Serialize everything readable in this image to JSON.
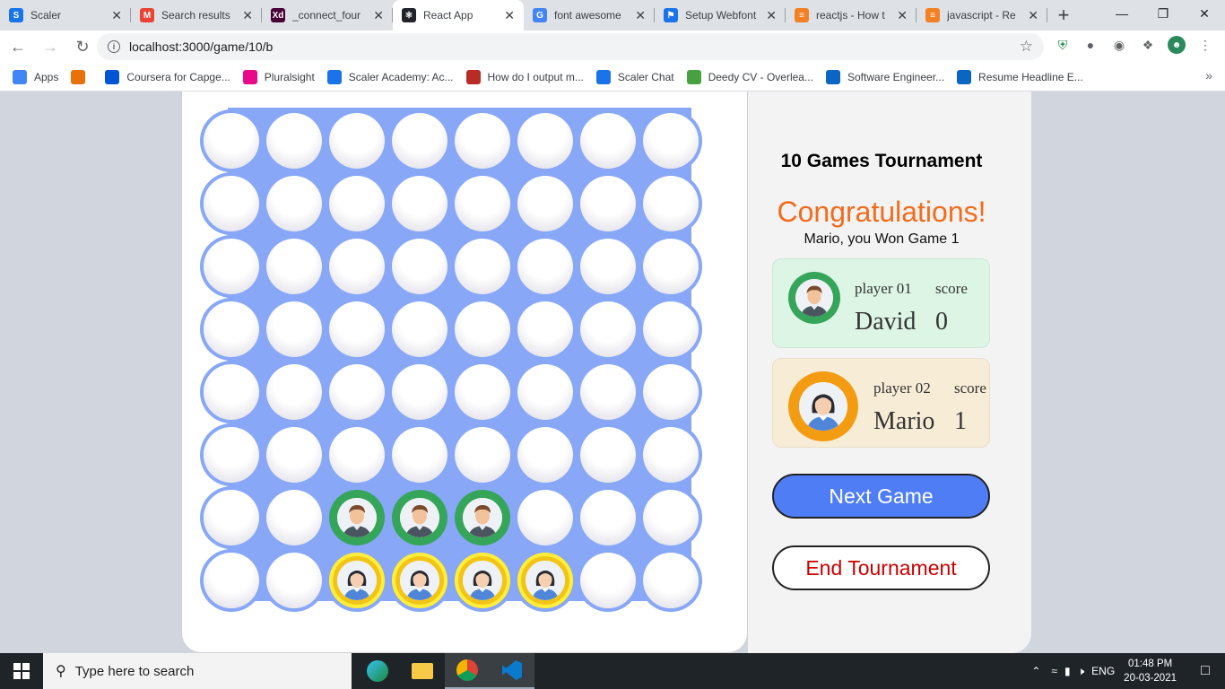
{
  "browser": {
    "tabs": [
      {
        "title": "Scaler",
        "favicon": "scaler-icon",
        "color": "#1a73e8",
        "active": false
      },
      {
        "title": "Search results",
        "favicon": "gmail-icon",
        "color": "#ea4335",
        "active": false
      },
      {
        "title": "_connect_four",
        "favicon": "adobe-xd-icon",
        "color": "#470137",
        "active": false
      },
      {
        "title": "React App",
        "favicon": "react-icon",
        "color": "#20232a",
        "active": true
      },
      {
        "title": "font awesome",
        "favicon": "google-icon",
        "color": "#4285f4",
        "active": false
      },
      {
        "title": "Setup Webfont",
        "favicon": "flag-icon",
        "color": "#1a73e8",
        "active": false
      },
      {
        "title": "reactjs - How t",
        "favicon": "stackoverflow-icon",
        "color": "#f48024",
        "active": false
      },
      {
        "title": "javascript - Re",
        "favicon": "stackoverflow-icon",
        "color": "#f48024",
        "active": false
      }
    ],
    "url": "localhost:3000/game/10/b",
    "bookmarks": [
      {
        "label": "Apps",
        "icon": "apps-grid-icon",
        "color": "#4285f4"
      },
      {
        "label": "",
        "icon": "library-icon",
        "color": "#e8710a"
      },
      {
        "label": "Coursera for Capge...",
        "icon": "coursera-icon",
        "color": "#0056d2"
      },
      {
        "label": "Pluralsight",
        "icon": "pluralsight-icon",
        "color": "#e80a89"
      },
      {
        "label": "Scaler Academy: Ac...",
        "icon": "scaler-icon",
        "color": "#1a73e8"
      },
      {
        "label": "How do I output m...",
        "icon": "quora-icon",
        "color": "#b92b27"
      },
      {
        "label": "Scaler Chat",
        "icon": "scaler-chat-icon",
        "color": "#1a73e8"
      },
      {
        "label": "Deedy CV - Overlea...",
        "icon": "overleaf-icon",
        "color": "#47a141"
      },
      {
        "label": "Software Engineer...",
        "icon": "kaggle-icon",
        "color": "#0a66c2"
      },
      {
        "label": "Resume Headline E...",
        "icon": "kaggle-icon",
        "color": "#0a66c2"
      }
    ]
  },
  "game": {
    "tournament_title": "10 Games Tournament",
    "congrats": "Congratulations!",
    "winner_message": "Mario, you Won Game 1",
    "players": [
      {
        "label": "player 01",
        "score_label": "score",
        "name": "David",
        "score": "0",
        "ring_color": "#35a55a",
        "card_bg": "#dcf5e4"
      },
      {
        "label": "player 02",
        "score_label": "score",
        "name": "Mario",
        "score": "1",
        "ring_color": "#f39c12",
        "card_bg": "#f7ecd6"
      }
    ],
    "next_button": "Next Game",
    "end_button": "End Tournament",
    "board": {
      "rows": 8,
      "cols": 8,
      "cells": [
        [
          0,
          0,
          0,
          0,
          0,
          0,
          0,
          0
        ],
        [
          0,
          0,
          0,
          0,
          0,
          0,
          0,
          0
        ],
        [
          0,
          0,
          0,
          0,
          0,
          0,
          0,
          0
        ],
        [
          0,
          0,
          0,
          0,
          0,
          0,
          0,
          0
        ],
        [
          0,
          0,
          0,
          0,
          0,
          0,
          0,
          0
        ],
        [
          0,
          0,
          0,
          0,
          0,
          0,
          0,
          0
        ],
        [
          0,
          0,
          1,
          1,
          1,
          0,
          0,
          0
        ],
        [
          0,
          0,
          2,
          2,
          2,
          2,
          0,
          0
        ]
      ]
    }
  },
  "taskbar": {
    "search_placeholder": "Type here to search",
    "language": "ENG",
    "time": "01:48 PM",
    "date": "20-03-2021"
  }
}
